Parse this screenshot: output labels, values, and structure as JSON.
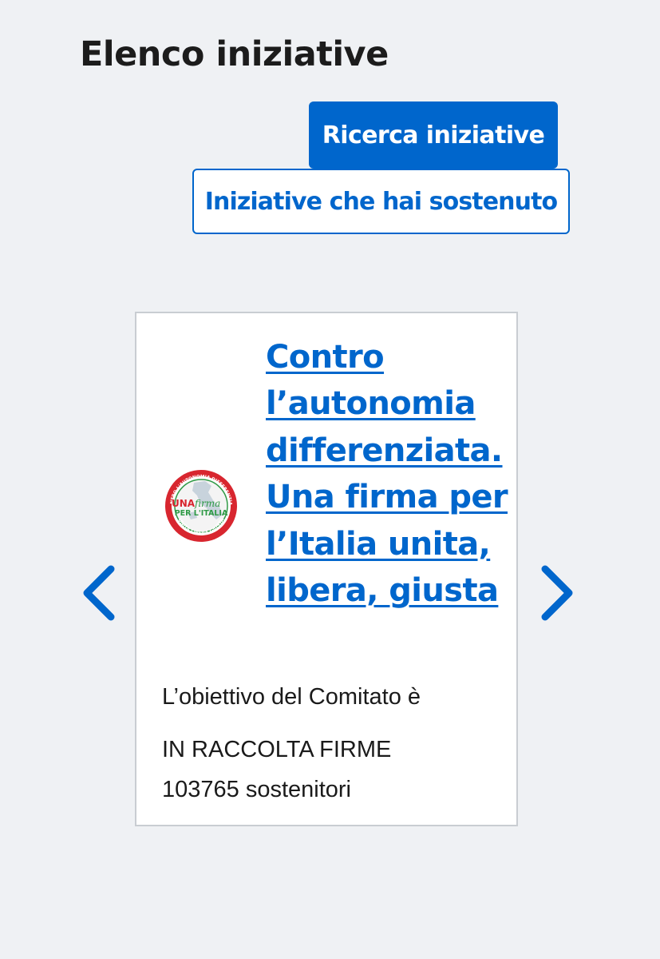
{
  "page": {
    "title": "Elenco iniziative"
  },
  "actions": {
    "search_label": "Ricerca iniziative",
    "supported_label": "Iniziative che hai sostenuto"
  },
  "colors": {
    "background": "#eff1f4",
    "primary": "#0066cc",
    "card_border": "#c9cdd2",
    "text": "#1a1a1a"
  },
  "carousel": {
    "prev_icon": "chevron-left-icon",
    "next_icon": "chevron-right-icon",
    "card": {
      "logo_icon": "una-firma-per-italia-logo",
      "logo_text": {
        "ring_top": "CONTRO L'AUTONOMIA DIFFERENZIATA",
        "line1": "UNA",
        "line1_script": "firma",
        "line2": "PER L'ITALIA",
        "ring_bottom": "UNITA LIBERA GIUSTA"
      },
      "title": "Contro l’autonomia differenziata. Una firma per l’Italia unita, libera, giusta",
      "description": "L’obiettivo del Comitato è",
      "status": "IN RACCOLTA FIRME",
      "supporters": "103765 sostenitori"
    }
  }
}
